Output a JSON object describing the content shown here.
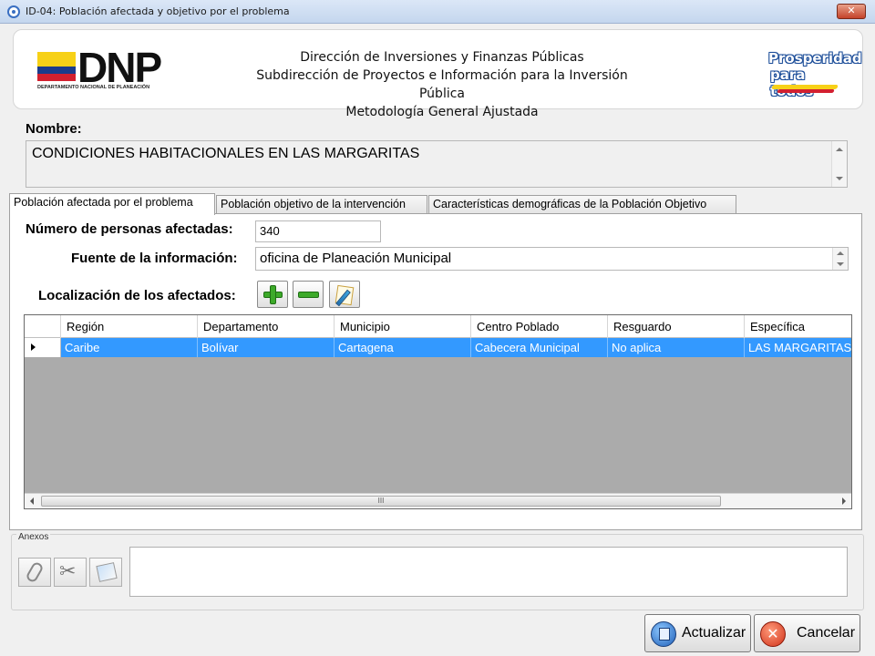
{
  "window": {
    "title": "ID-04: Población afectada y objetivo por el problema",
    "close_glyph": "✕"
  },
  "header": {
    "logo_left_text": "DNP",
    "logo_left_subtext": "DEPARTAMENTO NACIONAL DE PLANEACIÓN",
    "line1": "Dirección de Inversiones y Finanzas Públicas",
    "line2": "Subdirección de Proyectos e Información para la Inversión Pública",
    "line3": "Metodología General Ajustada",
    "logo_right_line1": "Prosperidad",
    "logo_right_line2": "para todos"
  },
  "nombre": {
    "label": "Nombre:",
    "value": "CONDICIONES HABITACIONALES EN LAS MARGARITAS"
  },
  "tabs": [
    {
      "label": "Población afectada por el problema",
      "active": true
    },
    {
      "label": "Población objetivo de la intervención",
      "active": false
    },
    {
      "label": "Características demográficas de la Población Objetivo",
      "active": false
    }
  ],
  "form": {
    "personas_label": "Número de personas afectadas:",
    "personas_value": "340",
    "fuente_label": "Fuente de la información:",
    "fuente_value": "oficina de Planeación Municipal",
    "localizacion_label": "Localización de los afectados:"
  },
  "grid": {
    "columns": [
      "Región",
      "Departamento",
      "Municipio",
      "Centro Poblado",
      "Resguardo",
      "Específica"
    ],
    "rows": [
      [
        "Caribe",
        "Bolívar",
        "Cartagena",
        "Cabecera Municipal",
        "No aplica",
        "LAS MARGARITAS"
      ]
    ],
    "scroll_grip": "III"
  },
  "anexos": {
    "title": "Anexos"
  },
  "buttons": {
    "actualizar": "Actualizar",
    "cancelar": "Cancelar",
    "cancel_glyph": "✕"
  },
  "colors": {
    "selection": "#3399ff",
    "grid_background": "#ababab"
  }
}
